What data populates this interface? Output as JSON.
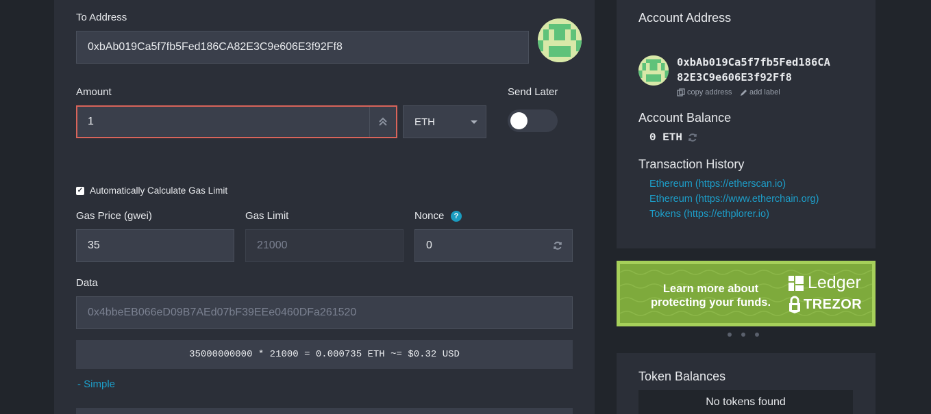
{
  "send_form": {
    "to_address_label": "To Address",
    "to_address_value": "0xbAb019Ca5f7fb5Fed186CA82E3C9e606E3f92Ff8",
    "amount_label": "Amount",
    "amount_value": "1",
    "unit_selected": "ETH",
    "send_later_label": "Send Later",
    "send_later_on": false,
    "auto_gas_label": "Automatically Calculate Gas Limit",
    "auto_gas_checked": true,
    "gas_price_label": "Gas Price (gwei)",
    "gas_price_value": "35",
    "gas_limit_label": "Gas Limit",
    "gas_limit_value": "21000",
    "nonce_label": "Nonce",
    "nonce_help": "?",
    "nonce_value": "0",
    "data_label": "Data",
    "data_placeholder": "0x4bbeEB066eD09B7AEd07bF39EEe0460DFa261520",
    "fee_calc": "35000000000 * 21000 = 0.000735 ETH ~= $0.32 USD",
    "simple_link": "- Simple"
  },
  "account": {
    "address_heading": "Account Address",
    "address_line1": "0xbAb019Ca5f7fb5Fed186CA",
    "address_line2": "82E3C9e606E3f92Ff8",
    "copy_address": "copy address",
    "add_label": "add label",
    "balance_heading": "Account Balance",
    "balance_value": "0 ETH",
    "history_heading": "Transaction History",
    "history_links": [
      "Ethereum (https://etherscan.io)",
      "Ethereum (https://www.etherchain.org)",
      "Tokens (https://ethplorer.io)"
    ]
  },
  "promo": {
    "text": "Learn more about protecting your funds.",
    "brand1": "Ledger",
    "brand2": "TREZOR"
  },
  "tokens": {
    "heading": "Token Balances",
    "empty": "No tokens found"
  },
  "colors": {
    "accent_link": "#1d9ec9",
    "error_border": "#d9645a",
    "promo_green": "#7eaa3c"
  }
}
